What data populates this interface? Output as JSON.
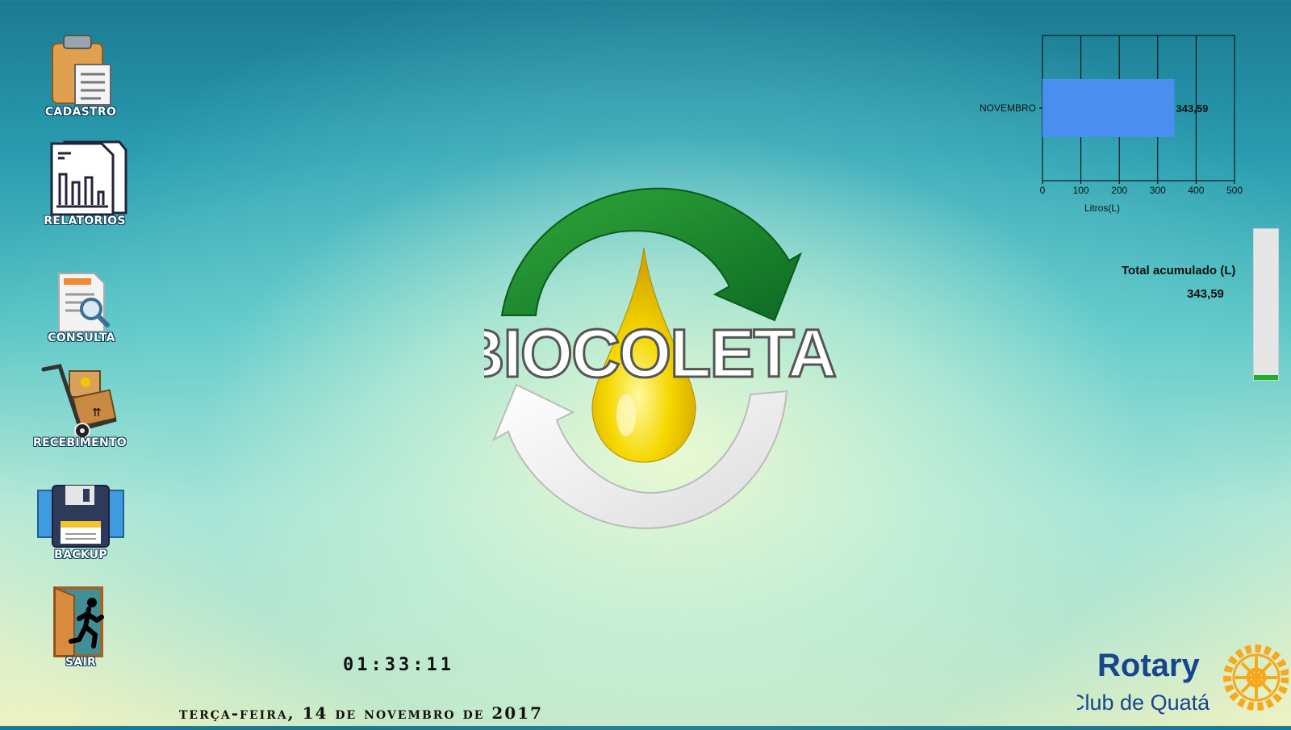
{
  "menu": {
    "items": [
      {
        "label": "CADASTRO",
        "icon": "clipboard-icon"
      },
      {
        "label": "RELATORIOS",
        "icon": "report-chart-icon"
      },
      {
        "label": "CONSULTA",
        "icon": "document-search-icon"
      },
      {
        "label": "RECEBIMENTO",
        "icon": "hand-truck-icon"
      },
      {
        "label": "BACKUP",
        "icon": "floppy-disk-icon"
      },
      {
        "label": "SAIR",
        "icon": "exit-door-icon"
      }
    ]
  },
  "logo": {
    "text": "BIOCOLETA",
    "icon": "recycle-oil-drop-icon"
  },
  "clock": "01:33:11",
  "date": "terça-feira, 14 de novembro de 2017",
  "chart_data": {
    "type": "bar",
    "orientation": "horizontal",
    "categories": [
      "NOVEMBRO"
    ],
    "values": [
      343.59
    ],
    "value_labels": [
      "343,59"
    ],
    "xlabel": "Litros(L)",
    "xlim": [
      0,
      500
    ],
    "xticks": [
      "0",
      "100",
      "200",
      "300",
      "400",
      "500"
    ],
    "grid": true,
    "bar_color": "#4a8ef0"
  },
  "total": {
    "label": "Total acumulado (L)",
    "value": "343,59",
    "fill_fraction": 0.03
  },
  "brand": {
    "name": "Rotary",
    "subtitle": "Club de Quatá",
    "icon": "rotary-wheel-icon",
    "colors": {
      "blue": "#17458f",
      "gold": "#f7a81b"
    }
  }
}
